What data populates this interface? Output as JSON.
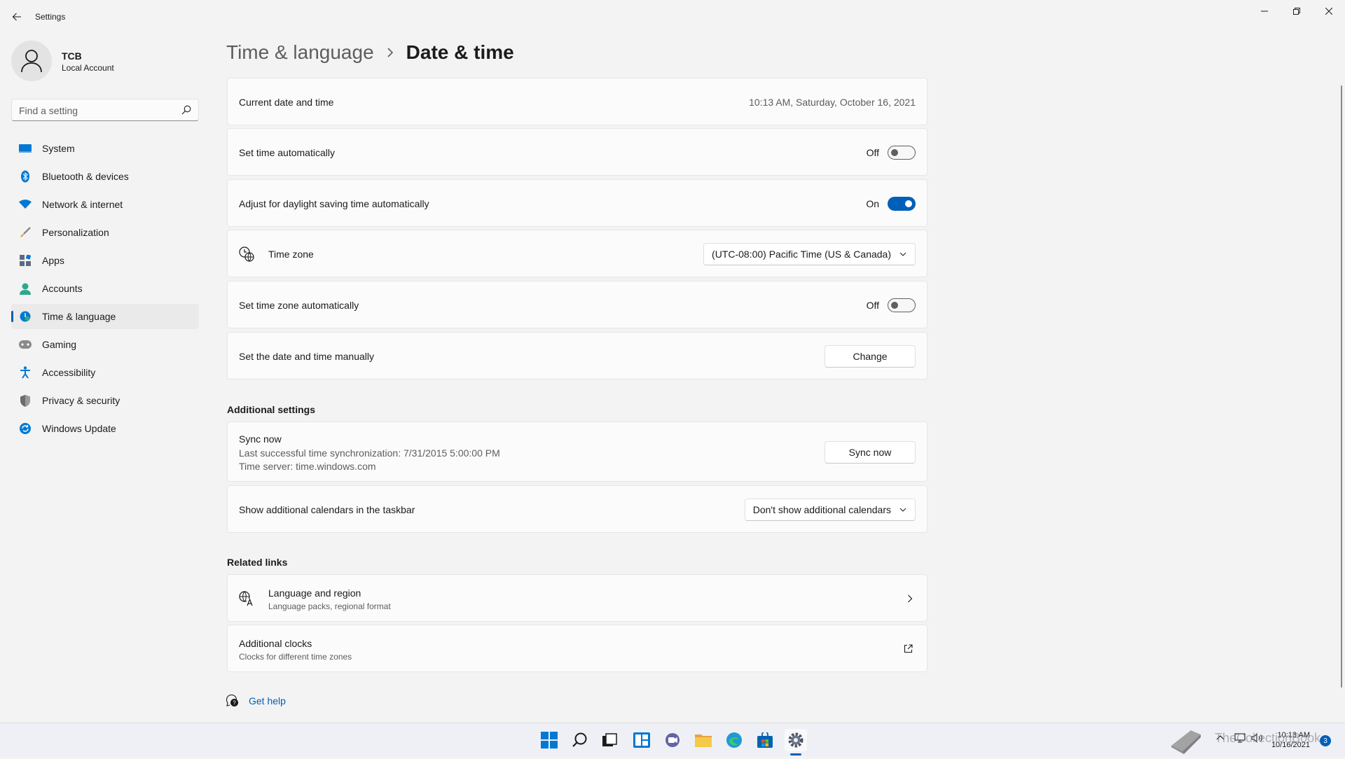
{
  "window": {
    "title": "Settings"
  },
  "profile": {
    "name": "TCB",
    "account_type": "Local Account"
  },
  "search": {
    "placeholder": "Find a setting"
  },
  "sidebar": {
    "items": [
      {
        "label": "System",
        "icon": "system-icon",
        "color": "#0078d4"
      },
      {
        "label": "Bluetooth & devices",
        "icon": "bluetooth-icon",
        "color": "#0078d4"
      },
      {
        "label": "Network & internet",
        "icon": "wifi-icon",
        "color": "#0078d4"
      },
      {
        "label": "Personalization",
        "icon": "brush-icon",
        "color": "#e8a33d"
      },
      {
        "label": "Apps",
        "icon": "apps-icon",
        "color": "#5d6b82"
      },
      {
        "label": "Accounts",
        "icon": "person-icon",
        "color": "#2ea88d"
      },
      {
        "label": "Time & language",
        "icon": "globe-clock-icon",
        "color": "#0078d4",
        "active": true
      },
      {
        "label": "Gaming",
        "icon": "gamepad-icon",
        "color": "#7a7a7a"
      },
      {
        "label": "Accessibility",
        "icon": "accessibility-icon",
        "color": "#0078d4"
      },
      {
        "label": "Privacy & security",
        "icon": "shield-icon",
        "color": "#6b6b6b"
      },
      {
        "label": "Windows Update",
        "icon": "update-icon",
        "color": "#0078d4"
      }
    ]
  },
  "breadcrumb": {
    "parent": "Time & language",
    "current": "Date & time"
  },
  "settings": {
    "current_datetime": {
      "label": "Current date and time",
      "value": "10:13 AM, Saturday, October 16, 2021"
    },
    "set_time_auto": {
      "label": "Set time automatically",
      "state": "Off"
    },
    "daylight_saving": {
      "label": "Adjust for daylight saving time automatically",
      "state": "On"
    },
    "time_zone": {
      "label": "Time zone",
      "value": "(UTC-08:00) Pacific Time (US & Canada)"
    },
    "set_tz_auto": {
      "label": "Set time zone automatically",
      "state": "Off"
    },
    "manual": {
      "label": "Set the date and time manually",
      "button": "Change"
    }
  },
  "additional": {
    "title": "Additional settings",
    "sync": {
      "label": "Sync now",
      "last_sync": "Last successful time synchronization: 7/31/2015 5:00:00 PM",
      "server": "Time server: time.windows.com",
      "button": "Sync now"
    },
    "calendars": {
      "label": "Show additional calendars in the taskbar",
      "value": "Don't show additional calendars"
    }
  },
  "related": {
    "title": "Related links",
    "language_region": {
      "label": "Language and region",
      "sub": "Language packs, regional format"
    },
    "additional_clocks": {
      "label": "Additional clocks",
      "sub": "Clocks for different time zones"
    }
  },
  "help": {
    "label": "Get help"
  },
  "taskbar": {
    "clock_time": "10:13 AM",
    "clock_date": "10/16/2021",
    "notification_count": "3",
    "watermark": "TheCollectionBook",
    "accent": "#005fb8"
  }
}
